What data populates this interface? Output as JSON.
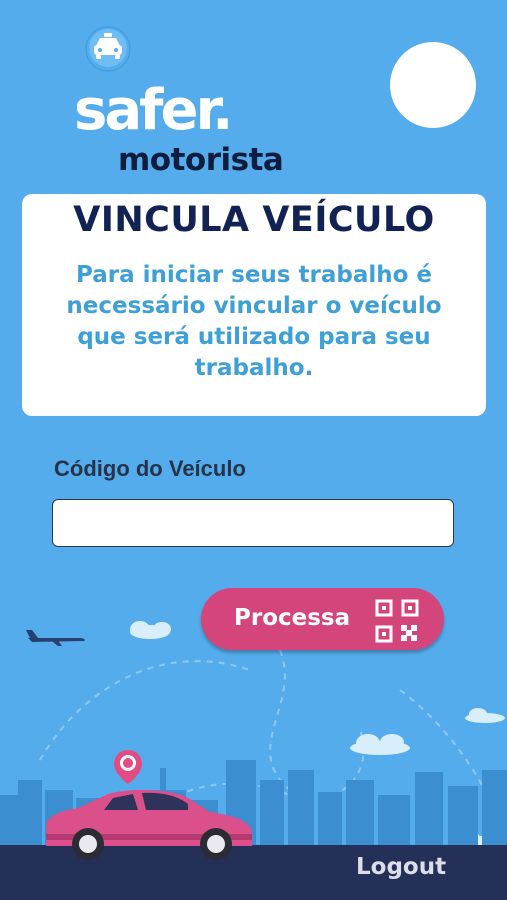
{
  "logo": {
    "brand": "safer.",
    "subtitle": "motorista"
  },
  "card": {
    "title": "VINCULA VEÍCULO",
    "description": "Para iniciar seus trabalho é necessário vincular o veículo que será utilizado para seu trabalho."
  },
  "form": {
    "label": "Código do Veículo",
    "value": "",
    "placeholder": ""
  },
  "actions": {
    "process_label": "Processa",
    "logout_label": "Logout"
  },
  "icons": [
    "taxi-pin-icon",
    "qr-code-icon",
    "airplane-icon",
    "location-pin-icon",
    "car-icon"
  ],
  "colors": {
    "background": "#55acec",
    "card_title": "#122353",
    "card_text": "#3ea0d6",
    "button": "#d4457c",
    "ground": "#243058"
  }
}
